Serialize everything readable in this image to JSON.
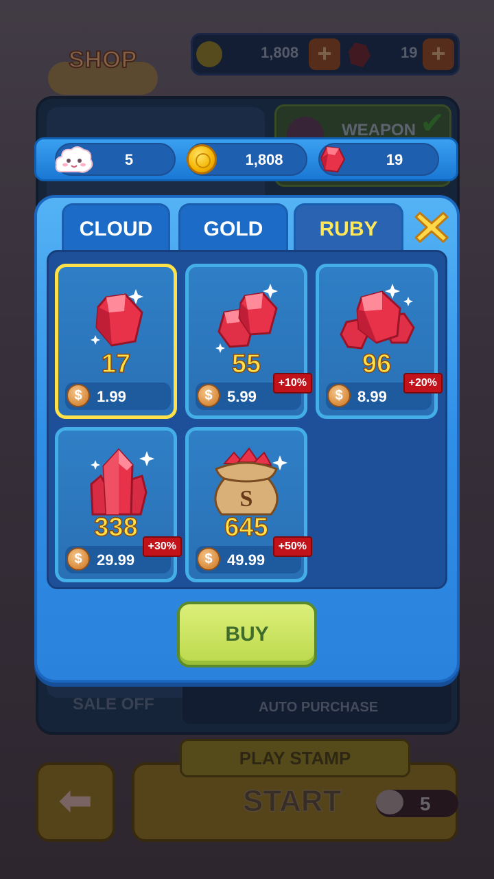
{
  "background": {
    "shop_title": "SHOP",
    "top_bar": {
      "gold": "1,808",
      "ruby": "19",
      "plus_label": "+"
    },
    "category_label": "WEAPON",
    "sale_label": "SALE OFF",
    "auto_purchase_label": "AUTO PURCHASE",
    "play_stamp_label": "PLAY STAMP",
    "start_label": "START",
    "start_cost": "5",
    "back_arrow": "arrow-left-icon"
  },
  "resources": {
    "cloud": {
      "icon": "cloud-icon",
      "value": "5"
    },
    "gold": {
      "icon": "coin-icon",
      "value": "1,808"
    },
    "ruby": {
      "icon": "ruby-icon",
      "value": "19"
    }
  },
  "tabs": [
    {
      "label": "CLOUD",
      "active": false
    },
    {
      "label": "GOLD",
      "active": false
    },
    {
      "label": "RUBY",
      "active": true
    }
  ],
  "close_icon": "close-x-icon",
  "products": [
    {
      "quantity": "17",
      "price": "1.99",
      "bonus": "",
      "selected": true,
      "art": "single-ruby"
    },
    {
      "quantity": "55",
      "price": "5.99",
      "bonus": "+10%",
      "selected": false,
      "art": "two-rubies"
    },
    {
      "quantity": "96",
      "price": "8.99",
      "bonus": "+20%",
      "selected": false,
      "art": "ruby-cluster-small"
    },
    {
      "quantity": "338",
      "price": "29.99",
      "bonus": "+30%",
      "selected": false,
      "art": "ruby-crystal"
    },
    {
      "quantity": "645",
      "price": "49.99",
      "bonus": "+50%",
      "selected": false,
      "art": "ruby-sack"
    }
  ],
  "price_currency_icon": "dollar-coin-icon",
  "price_currency_symbol": "$",
  "sack_letter": "S",
  "buy_label": "BUY",
  "colors": {
    "panel_blue": "#2f8ee6",
    "selected_border": "#ffe14a",
    "quantity_yellow": "#ffe14a",
    "bonus_red": "#c2131b",
    "buy_green": "#c8e25a"
  }
}
